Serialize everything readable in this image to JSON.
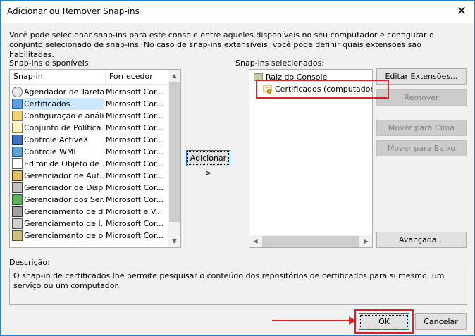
{
  "window": {
    "title": "Adicionar ou Remover Snap-ins",
    "close_glyph": "✕"
  },
  "intro": "Você pode selecionar snap-ins para este console entre aqueles disponíveis no seu computador e configurar o conjunto selecionado de snap-ins. No caso de snap-ins extensíveis, você pode definir quais extensões são habilitadas.",
  "available": {
    "label": "Snap-ins disponíveis:",
    "col_snapin": "Snap-in",
    "col_vendor": "Fornecedor",
    "items": [
      {
        "name": "Agendador de Tarefas",
        "vendor": "Microsoft Cor...",
        "icon": "clock-icon"
      },
      {
        "name": "Certificados",
        "vendor": "Microsoft Cor...",
        "icon": "certificates-icon"
      },
      {
        "name": "Configuração e análi...",
        "vendor": "Microsoft Cor...",
        "icon": "security-config-icon"
      },
      {
        "name": "Conjunto de Política...",
        "vendor": "Microsoft Cor...",
        "icon": "policy-icon"
      },
      {
        "name": "Controle ActiveX",
        "vendor": "Microsoft Cor...",
        "icon": "activex-icon"
      },
      {
        "name": "Controle WMI",
        "vendor": "Microsoft Cor...",
        "icon": "wmi-icon"
      },
      {
        "name": "Editor de Objeto de ...",
        "vendor": "Microsoft Cor...",
        "icon": "object-editor-icon"
      },
      {
        "name": "Gerenciador de Aut...",
        "vendor": "Microsoft Cor...",
        "icon": "auth-manager-icon"
      },
      {
        "name": "Gerenciador de Disp...",
        "vendor": "Microsoft Cor...",
        "icon": "device-manager-icon"
      },
      {
        "name": "Gerenciador dos Ser...",
        "vendor": "Microsoft Cor...",
        "icon": "server-manager-icon"
      },
      {
        "name": "Gerenciamento de di...",
        "vendor": "Microsoft e V...",
        "icon": "disk-management-icon"
      },
      {
        "name": "Gerenciamento de I...",
        "vendor": "Microsoft Cor...",
        "icon": "print-management-icon"
      },
      {
        "name": "Gerenciamento de p...",
        "vendor": "Microsoft Cor...",
        "icon": "management-icon"
      }
    ]
  },
  "add_button": "Adicionar >",
  "selected": {
    "label": "Snap-ins selecionados:",
    "root": "Raiz do Console",
    "child": "Certificados (computador local)"
  },
  "buttons": {
    "edit_ext": "Editar Extensões...",
    "remove": "Remover",
    "move_up": "Mover para Cima",
    "move_down": "Mover para Baixo",
    "advanced": "Avançada..."
  },
  "description": {
    "label": "Descrição:",
    "text": "O snap-in de certificados lhe permite pesquisar o conteúdo dos repositórios de certificados para si mesmo, um serviço ou um computador."
  },
  "footer": {
    "ok": "OK",
    "cancel": "Cancelar"
  },
  "colors": {
    "highlight": "#e41e24",
    "selection": "#cce8ff",
    "accent": "#0078d7"
  }
}
